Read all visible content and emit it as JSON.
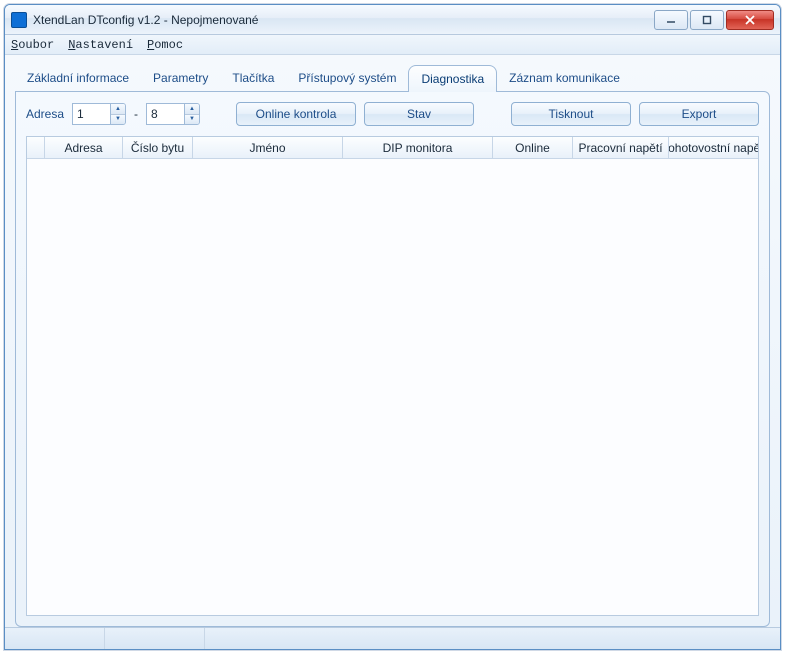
{
  "window": {
    "title": "XtendLan DTconfig v1.2 - Nepojmenované"
  },
  "menu": {
    "items": [
      "Soubor",
      "Nastavení",
      "Pomoc"
    ]
  },
  "tabs": {
    "items": [
      {
        "label": "Základní informace"
      },
      {
        "label": "Parametry"
      },
      {
        "label": "Tlačítka"
      },
      {
        "label": "Přístupový systém"
      },
      {
        "label": "Diagnostika",
        "active": true
      },
      {
        "label": "Záznam komunikace"
      }
    ]
  },
  "toolbar": {
    "addr_label": "Adresa",
    "addr_from": "1",
    "addr_to": "8",
    "btn_online": "Online kontrola",
    "btn_state": "Stav",
    "btn_print": "Tisknout",
    "btn_export": "Export"
  },
  "grid": {
    "columns": [
      "",
      "Adresa",
      "Číslo bytu",
      "Jméno",
      "DIP monitora",
      "Online",
      "Pracovní napětí",
      "Pohotovostní napětí"
    ]
  }
}
